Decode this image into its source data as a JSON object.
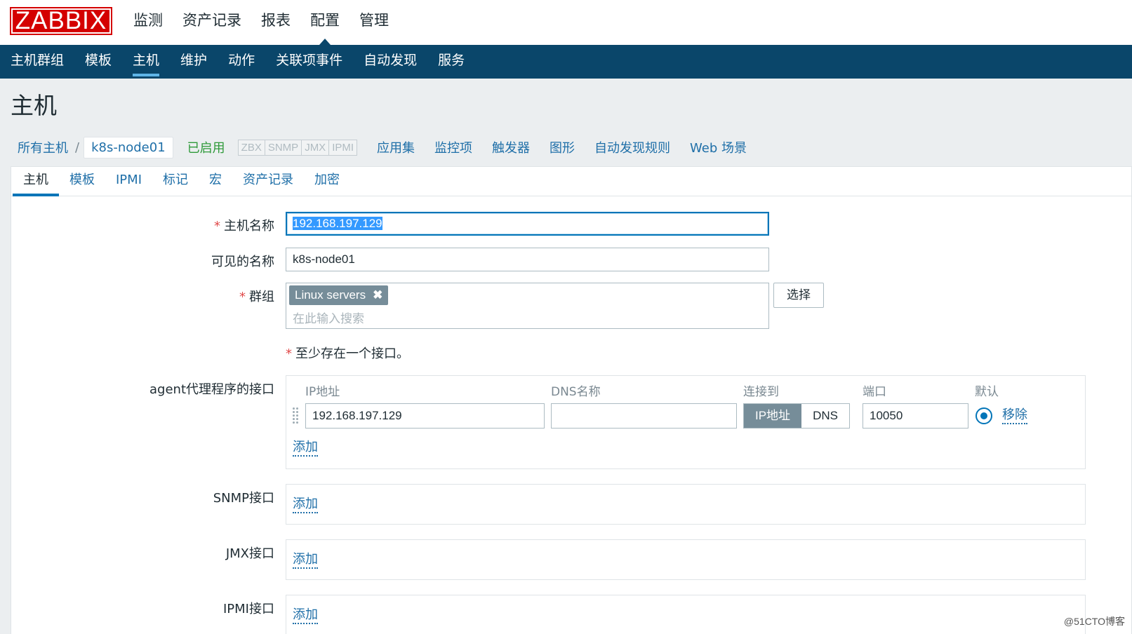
{
  "logo": "ZABBIX",
  "top_menu": [
    "监测",
    "资产记录",
    "报表",
    "配置",
    "管理"
  ],
  "sub_menu": [
    "主机群组",
    "模板",
    "主机",
    "维护",
    "动作",
    "关联项事件",
    "自动发现",
    "服务"
  ],
  "page_title": "主机",
  "host_nav": {
    "all_hosts": "所有主机",
    "separator": "/",
    "current_host": "k8s-node01",
    "status": "已启用",
    "availability": [
      "ZBX",
      "SNMP",
      "JMX",
      "IPMI"
    ],
    "links": [
      "应用集",
      "监控项",
      "触发器",
      "图形",
      "自动发现规则",
      "Web 场景"
    ]
  },
  "tabs": [
    "主机",
    "模板",
    "IPMI",
    "标记",
    "宏",
    "资产记录",
    "加密"
  ],
  "form": {
    "required_mark": "*",
    "host_name_label": "主机名称",
    "host_name_value": "192.168.197.129",
    "visible_name_label": "可见的名称",
    "visible_name_value": "k8s-node01",
    "groups_label": "群组",
    "group_tag": "Linux servers",
    "group_tag_remove": "✖",
    "groups_placeholder": "在此输入搜索",
    "select_button": "选择",
    "interface_hint": "至少存在一个接口。",
    "agent_label": "agent代理程序的接口",
    "columns": {
      "ip": "IP地址",
      "dns": "DNS名称",
      "connect": "连接到",
      "port": "端口",
      "default": "默认"
    },
    "agent_ip": "192.168.197.129",
    "agent_dns": "",
    "connect_ip": "IP地址",
    "connect_dns": "DNS",
    "agent_port": "10050",
    "remove": "移除",
    "add": "添加",
    "snmp_label": "SNMP接口",
    "jmx_label": "JMX接口",
    "ipmi_label": "IPMI接口"
  },
  "watermark": "@51CTO博客",
  "colors": {
    "brand_red": "#d40000",
    "nav_blue": "#0a466a",
    "link_blue": "#1f6fa8",
    "enabled_green": "#2f9a3a"
  }
}
